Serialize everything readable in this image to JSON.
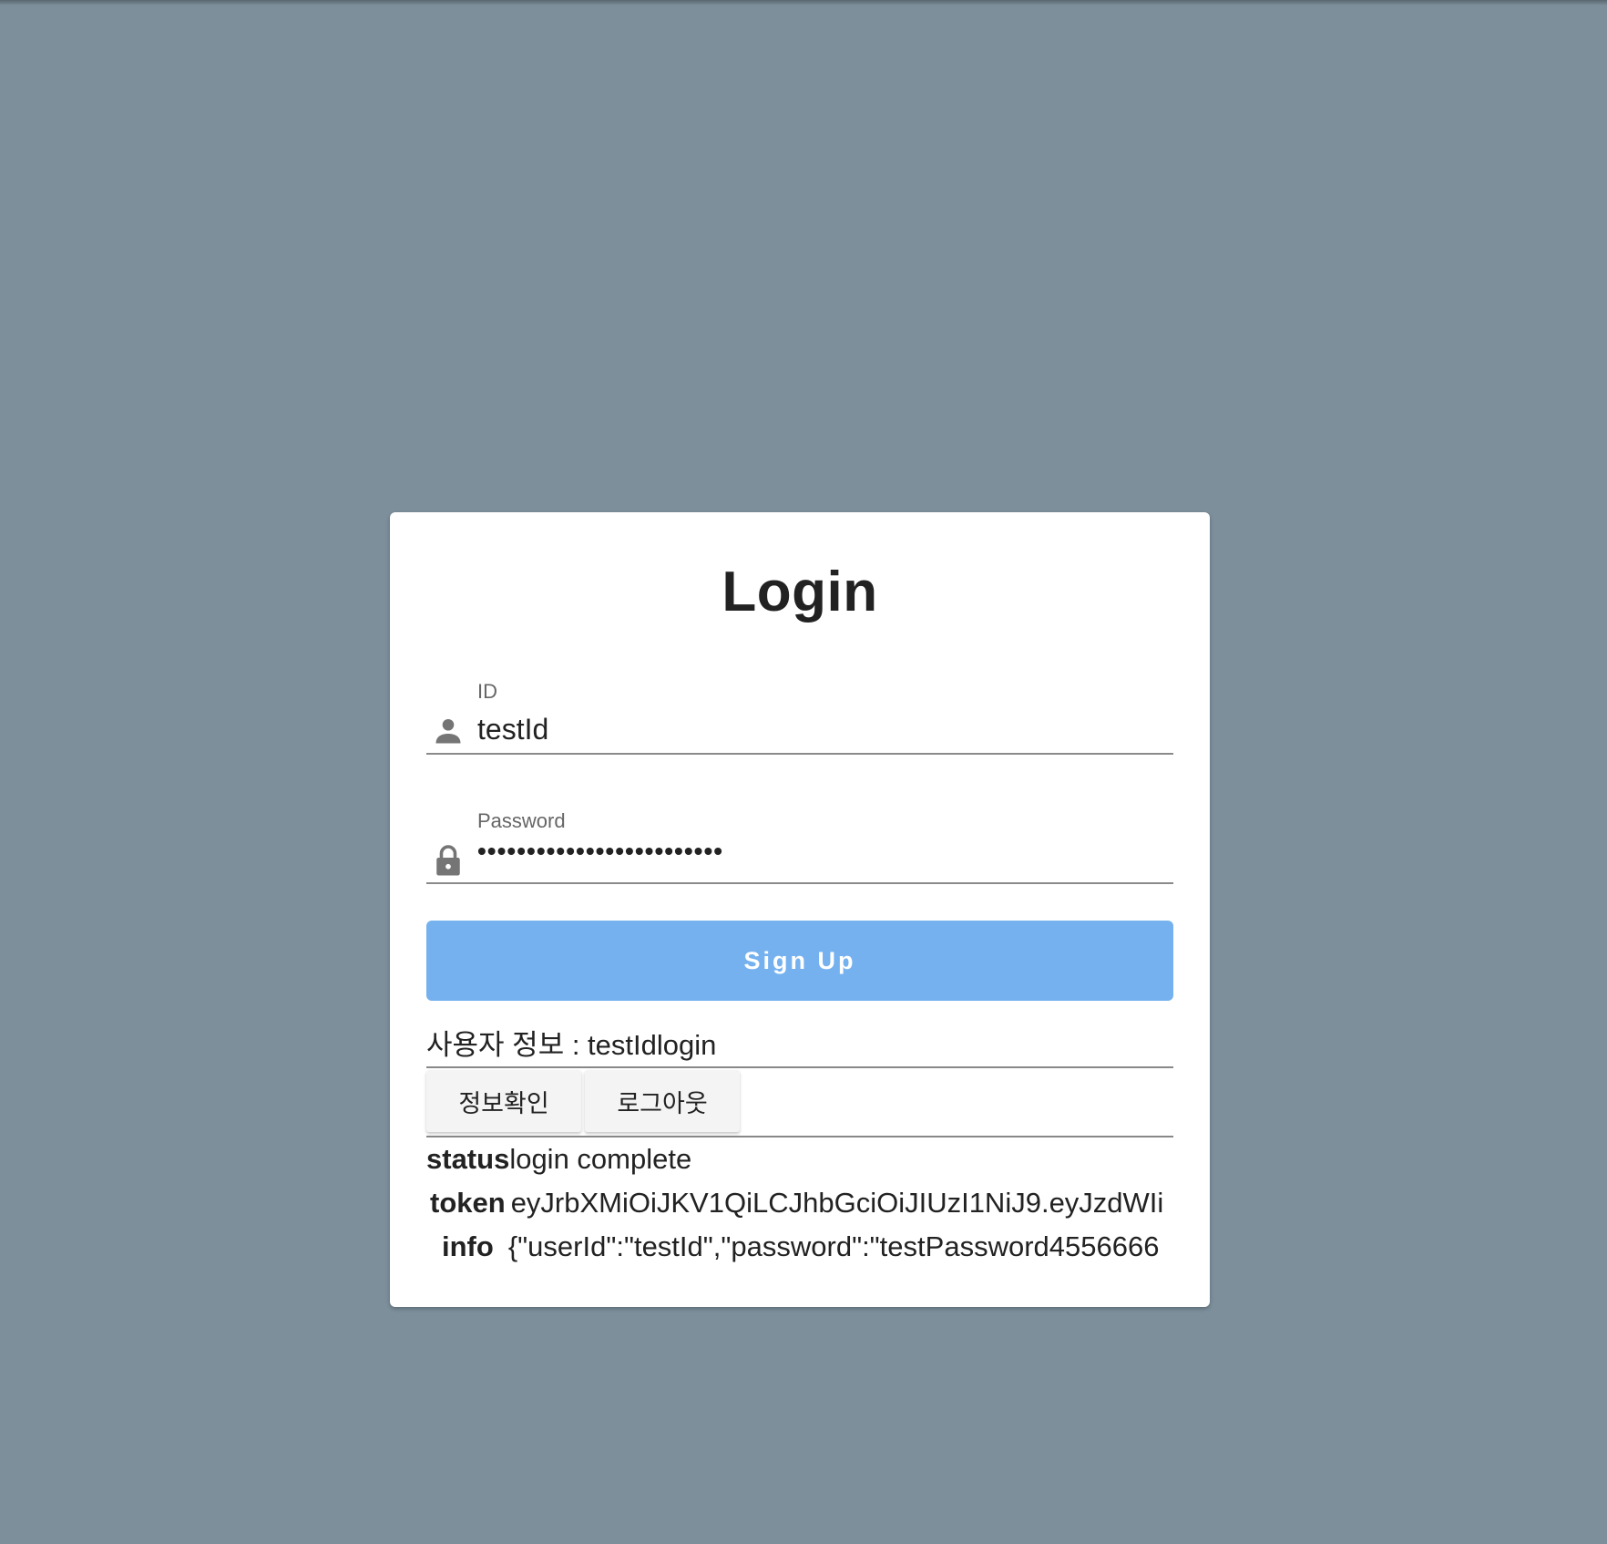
{
  "title": "Login",
  "id_field": {
    "label": "ID",
    "value": "testId",
    "icon": "person-icon"
  },
  "password_field": {
    "label": "Password",
    "masked_value": "•••••••••••••••••••••••••",
    "icon": "lock-icon"
  },
  "signup_button": {
    "label": "Sign Up",
    "color": "#75b1ef"
  },
  "user_info": {
    "text": "사용자 정보 : testIdlogin"
  },
  "actions": {
    "info_label": "정보확인",
    "logout_label": "로그아웃"
  },
  "details": {
    "status_key": "status",
    "status_value": "login complete",
    "token_key": "token",
    "token_value": "eyJrbXMiOiJKV1QiLCJhbGciOiJIUzI1NiJ9.eyJzdWIi",
    "info_key": "info",
    "info_value": "{\"userId\":\"testId\",\"password\":\"testPassword4556666"
  },
  "colors": {
    "background": "#7c8f9b",
    "card": "#ffffff"
  }
}
